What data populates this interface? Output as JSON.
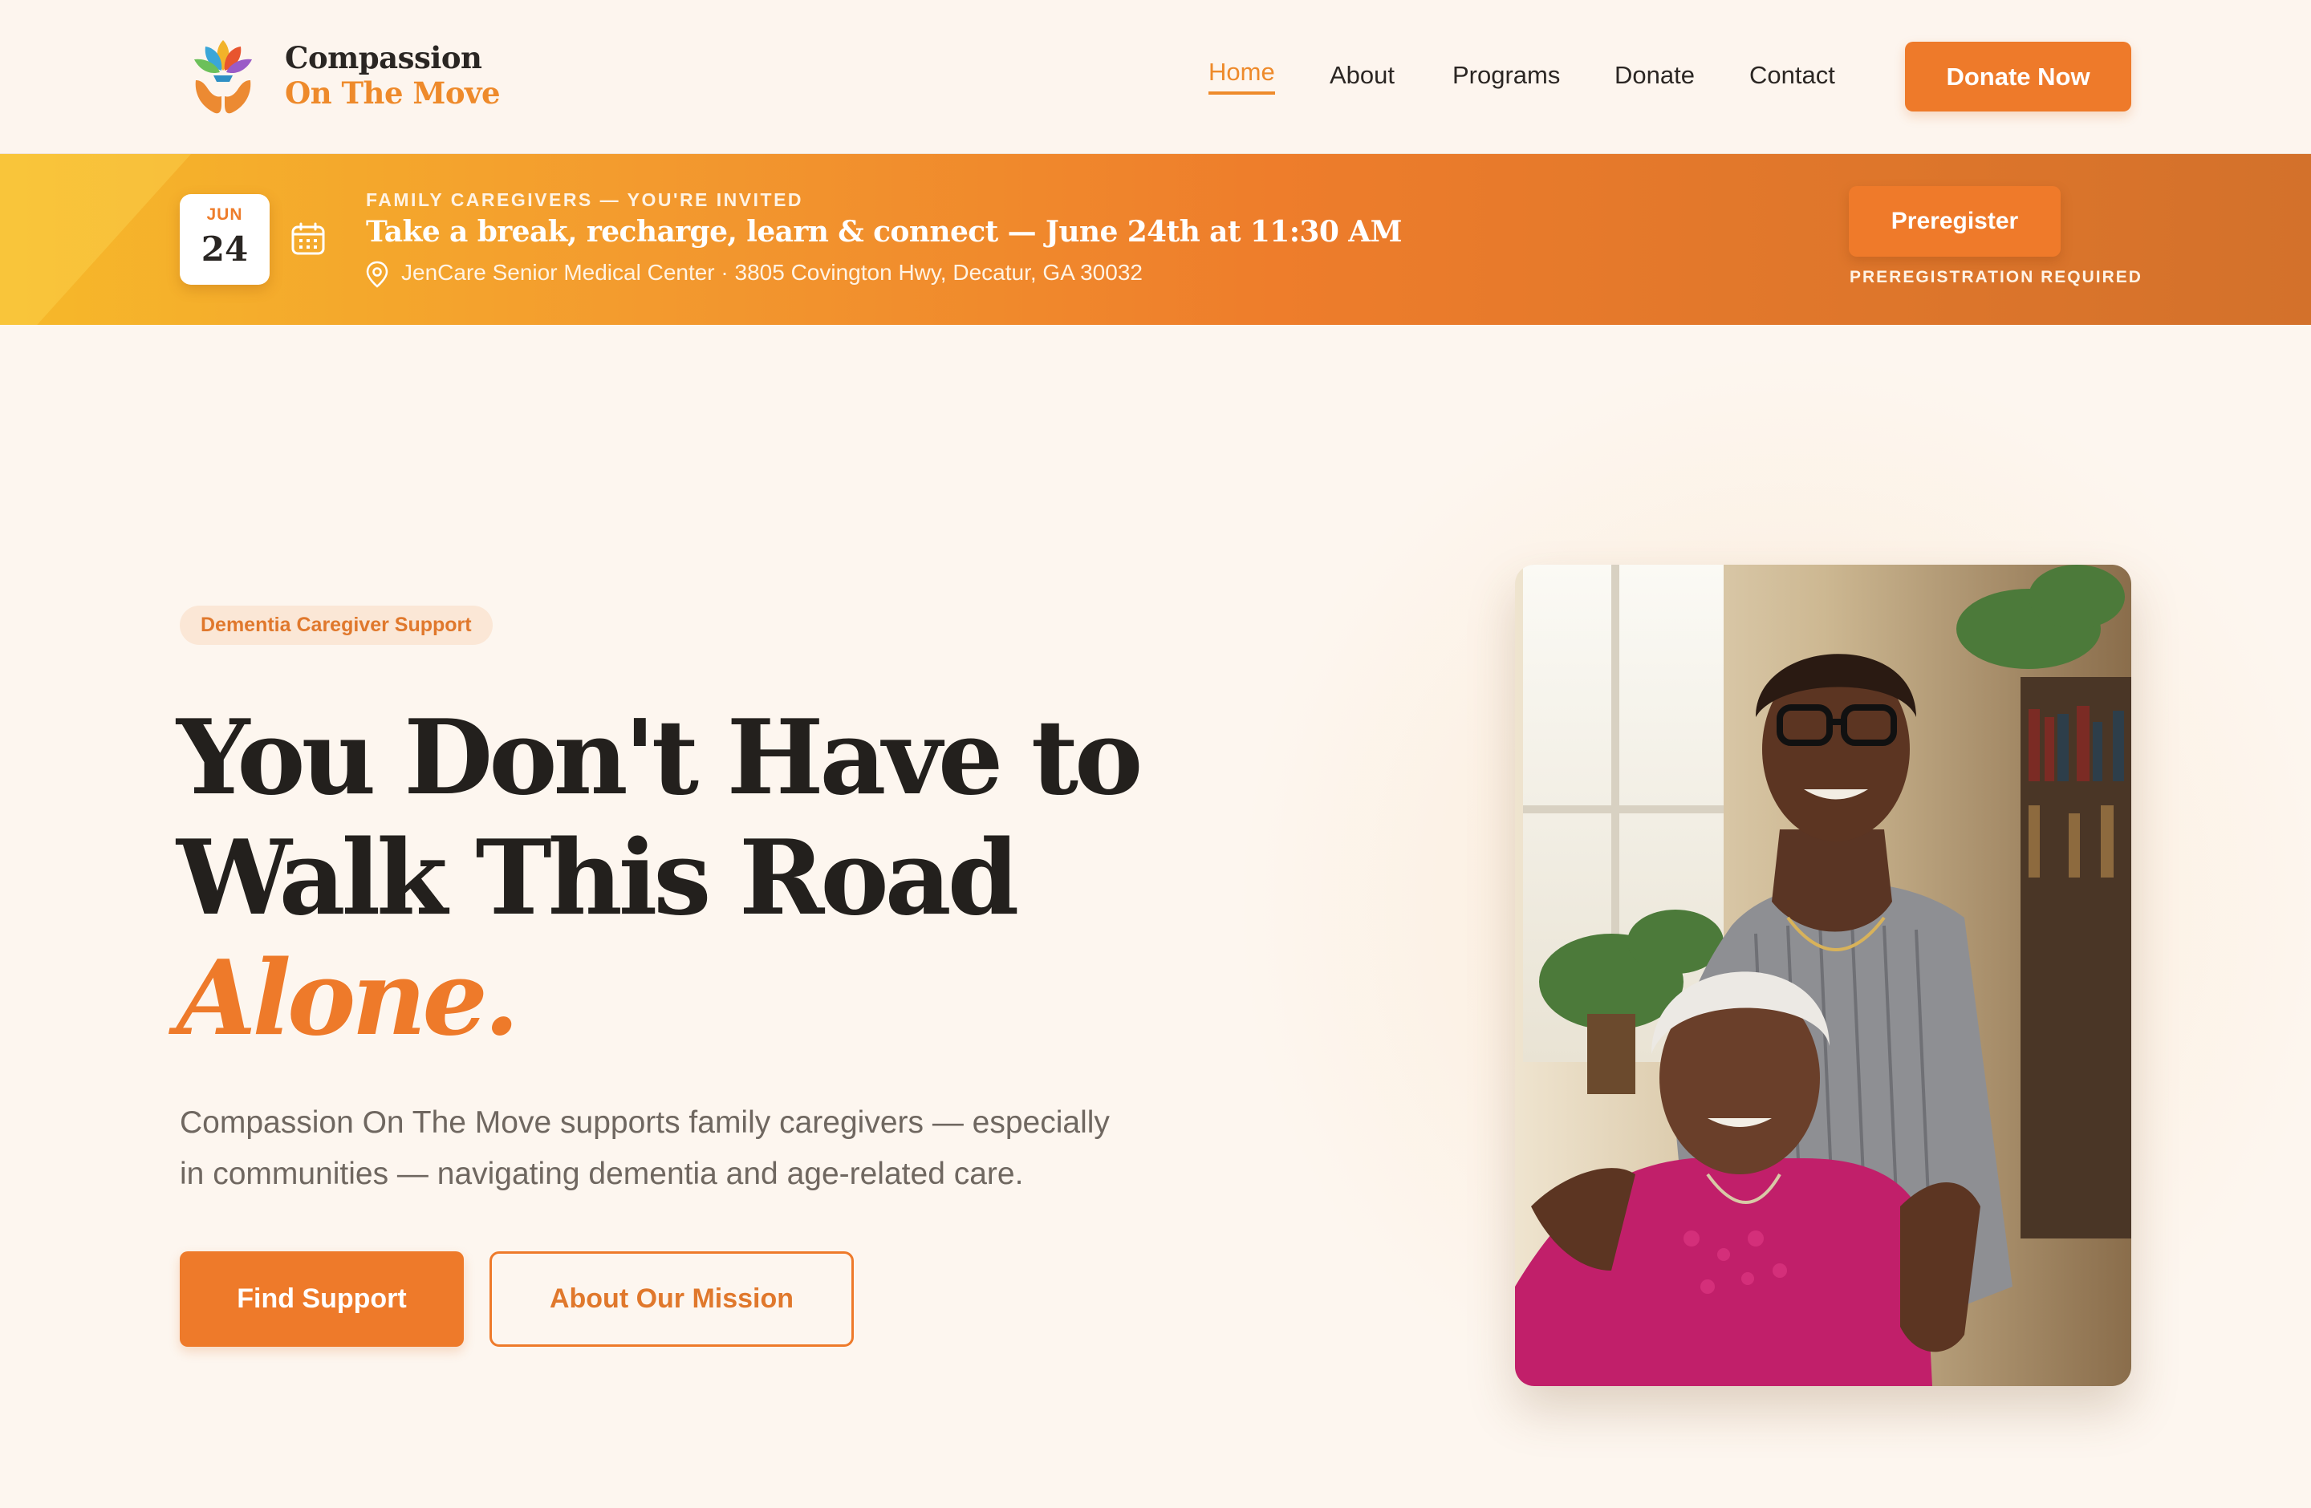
{
  "brand": {
    "line1": "Compassion",
    "line2": "On The Move"
  },
  "nav": {
    "items": [
      {
        "label": "Home",
        "active": true
      },
      {
        "label": "About"
      },
      {
        "label": "Programs"
      },
      {
        "label": "Donate"
      },
      {
        "label": "Contact"
      }
    ],
    "cta_label": "Donate Now"
  },
  "event": {
    "month": "JUN",
    "day": "24",
    "eyebrow": "FAMILY CAREGIVERS — YOU'RE INVITED",
    "title": "Take a break, recharge, learn & connect — June 24th at 11:30 AM",
    "location": "JenCare Senior Medical Center · 3805 Covington Hwy, Decatur, GA 30032",
    "button_label": "Preregister",
    "note": "PREREGISTRATION REQUIRED"
  },
  "hero": {
    "tag": "Dementia Caregiver Support",
    "title_line1": "You Don't Have to",
    "title_line2": "Walk This Road",
    "title_accent": "Alone.",
    "description": "Compassion On The Move supports family caregivers — especially in communities — navigating dementia and age-related care.",
    "primary_button": "Find Support",
    "secondary_button": "About Our Mission"
  },
  "colors": {
    "accent": "#ee7a2a",
    "background": "#fdf6ef",
    "text": "#23201d",
    "banner_start": "#f6b92a",
    "banner_end": "#d3712b"
  },
  "icons": [
    "lotus-hands-logo-icon",
    "calendar-icon",
    "location-pin-icon"
  ]
}
